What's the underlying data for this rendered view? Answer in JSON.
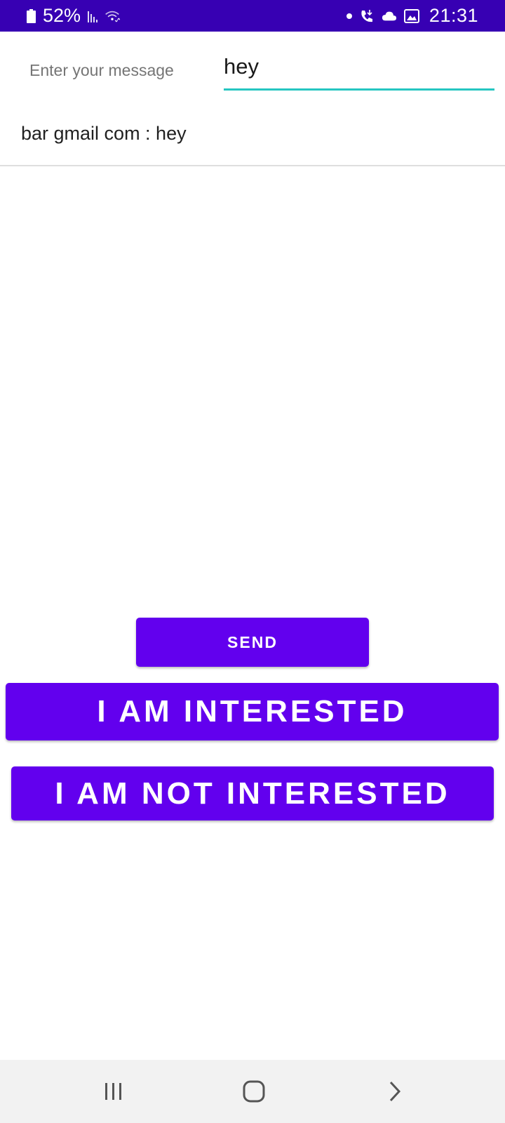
{
  "status_bar": {
    "battery": "52%",
    "time": "21:31",
    "icons": [
      "battery-icon",
      "signal-icon",
      "wifi-icon",
      "notification-dot-icon",
      "call-icon",
      "cloud-icon",
      "image-icon"
    ]
  },
  "message_entry": {
    "label": "Enter your message",
    "value": "hey"
  },
  "messages": [
    {
      "text": "bar gmail com : hey"
    }
  ],
  "buttons": {
    "send": "SEND",
    "interested": "I AM INTERESTED",
    "not_interested": "I AM NOT INTERESTED"
  },
  "nav_bar": {
    "icons": [
      "recents-icon",
      "home-icon",
      "back-icon"
    ]
  },
  "colors": {
    "status_bar": "#3700b3",
    "button": "#6200ee",
    "input_underline": "#26c6c1"
  }
}
